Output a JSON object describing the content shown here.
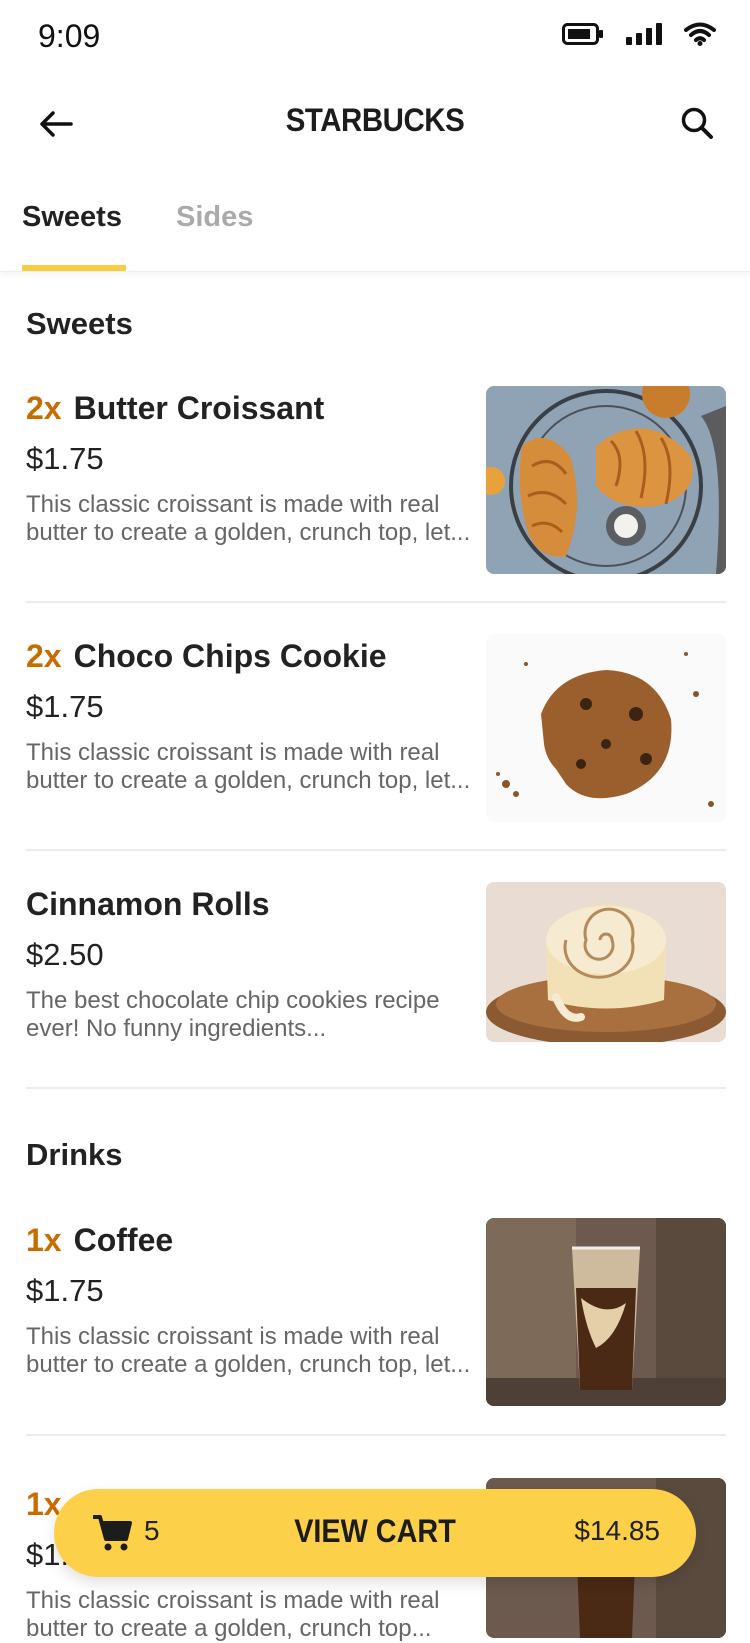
{
  "status": {
    "time": "9:09",
    "icons": [
      "battery-icon",
      "signal-icon",
      "wifi-icon"
    ]
  },
  "header": {
    "title": "STARBUCKS",
    "back_icon": "back-arrow-icon",
    "search_icon": "search-icon"
  },
  "tabs": [
    {
      "label": "Sweets",
      "active": true
    },
    {
      "label": "Sides",
      "active": false
    }
  ],
  "sections": [
    {
      "title": "Sweets",
      "items": [
        {
          "qty": "2x",
          "name": "Butter Croissant",
          "price": "$1.75",
          "description": "This classic croissant is made with real butter to create a golden, crunch top, let..."
        },
        {
          "qty": "2x",
          "name": "Choco Chips Cookie",
          "price": "$1.75",
          "description": "This classic croissant is made with real butter to create a golden, crunch top, let..."
        },
        {
          "qty": "",
          "name": "Cinnamon Rolls",
          "price": "$2.50",
          "description": "The best chocolate chip cookies recipe ever! No funny ingredients..."
        }
      ]
    },
    {
      "title": "Drinks",
      "items": [
        {
          "qty": "1x",
          "name": "Coffee",
          "price": "$1.75",
          "description": "This classic croissant is made with real butter to create a golden, crunch top, let..."
        },
        {
          "qty": "1x",
          "name": "",
          "price": "$1.",
          "description": "This classic croissant is made with real butter to create a golden, crunch top..."
        }
      ]
    }
  ],
  "cart": {
    "count": "5",
    "label": "VIEW CART",
    "total": "$14.85",
    "icon": "cart-icon"
  },
  "colors": {
    "accent": "#fdd04a",
    "qty": "#c86c00",
    "tab_inactive": "#aaaaaa"
  }
}
